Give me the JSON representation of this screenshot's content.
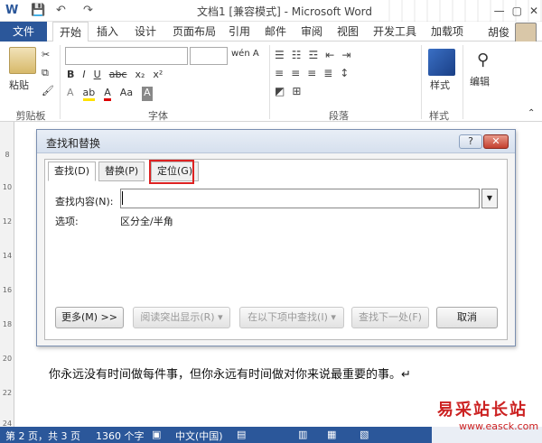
{
  "window": {
    "title": "文档1 [兼容模式] - Microsoft Word",
    "minimize": "—",
    "restore": "▢",
    "close": "✕",
    "quick_access": [
      "W",
      "💾",
      "↶",
      "↷"
    ]
  },
  "ribbon_tabs": [
    "文件",
    "开始",
    "插入",
    "设计",
    "页面布局",
    "引用",
    "邮件",
    "审阅",
    "视图",
    "开发工具",
    "加载项"
  ],
  "active_tab": "开始",
  "user": "胡俊",
  "ribbon": {
    "clipboard": {
      "paste": "粘贴",
      "label": "剪贴板"
    },
    "font": {
      "label": "字体",
      "font_name": "",
      "font_size": "",
      "wen_a": "wén A",
      "row2": [
        "B",
        "I",
        "U",
        "abc",
        "x₂",
        "x²"
      ],
      "row3": [
        "A",
        "Aa",
        "A",
        "A"
      ]
    },
    "paragraph": {
      "label": "段落"
    },
    "styles": {
      "button": "样式",
      "label": "样式"
    },
    "editing": {
      "button": "编辑"
    }
  },
  "document": {
    "text": "你永远没有时间做每件事，但你永远有时间做对你来说最重要的事。↵",
    "ruler_numbers": [
      "8",
      "10",
      "12",
      "14",
      "16",
      "18",
      "20",
      "22",
      "24"
    ]
  },
  "dialog": {
    "title": "查找和替换",
    "help": "?",
    "close": "✕",
    "tabs": {
      "find": "查找(D)",
      "replace": "替换(P)",
      "goto": "定位(G)"
    },
    "find_label": "查找内容(N):",
    "find_value": "",
    "options_label": "选项:",
    "options_value": "区分全/半角",
    "buttons": {
      "more": "更多(M) >>",
      "reading_highlight": "阅读突出显示(R) ▾",
      "find_in": "在以下项中查找(I) ▾",
      "find_next": "查找下一处(F)",
      "cancel": "取消"
    }
  },
  "status": {
    "page": "第 2 页，共 3 页",
    "words": "1360 个字",
    "language": "中文(中国)"
  },
  "watermark": {
    "cn": "易采站长站",
    "url": "www.easck.com"
  },
  "colors": {
    "accent": "#2b579a",
    "highlight_border": "#dd2222",
    "close_red": "#c4402f"
  }
}
